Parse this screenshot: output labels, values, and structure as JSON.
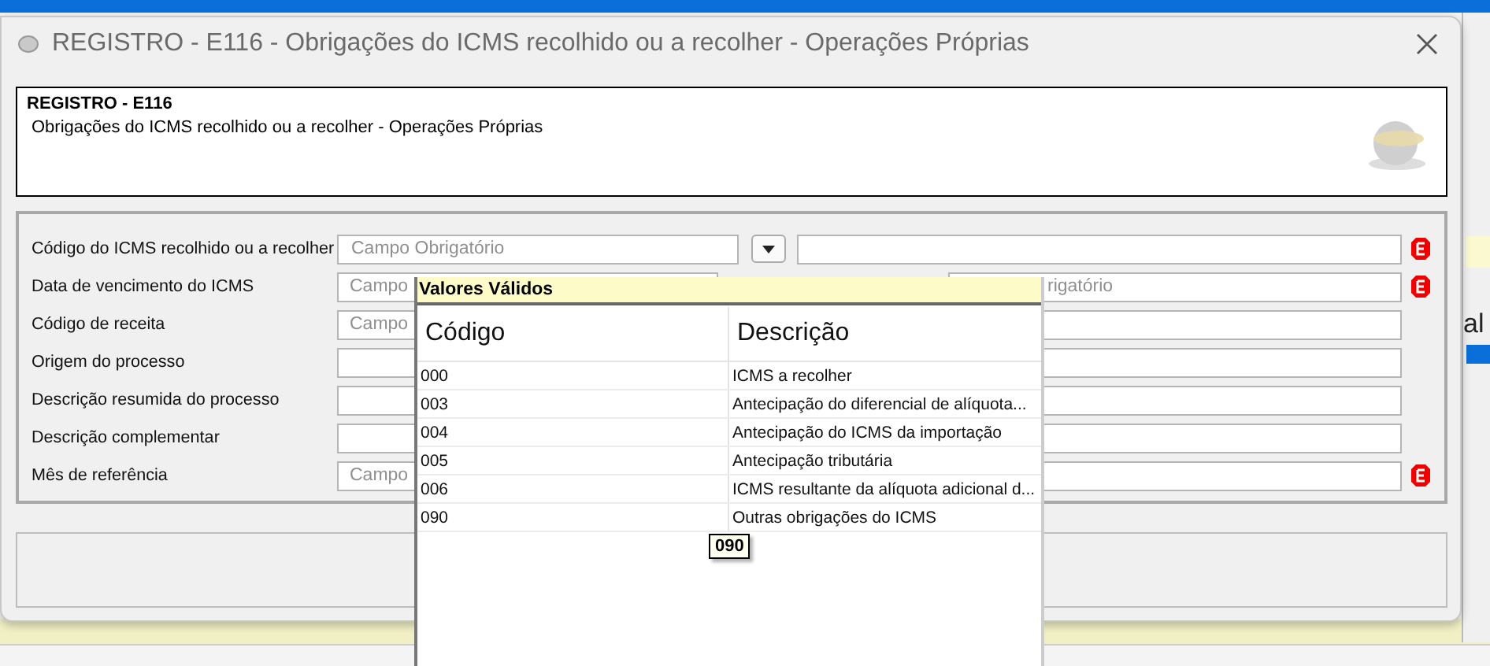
{
  "window": {
    "title": "REGISTRO - E116 - Obrigações do ICMS recolhido ou a recolher - Operações Próprias"
  },
  "header": {
    "code": "REGISTRO - E116",
    "description": "Obrigações do ICMS recolhido ou a recolher - Operações Próprias"
  },
  "fields": [
    {
      "label": "Código do ICMS recolhido ou a recolher",
      "kind": "combo",
      "placeholder": "Campo Obrigatório",
      "required": true
    },
    {
      "label": "Data de vencimento do ICMS",
      "kind": "pair",
      "placeholder": "Campo",
      "placeholder_right": "rigatório",
      "required": true
    },
    {
      "label": "Código de receita",
      "kind": "pair",
      "placeholder": "Campo",
      "required": false
    },
    {
      "label": "Origem do processo",
      "kind": "pair",
      "required": false
    },
    {
      "label": "Descrição resumida do processo",
      "kind": "pair",
      "required": false
    },
    {
      "label": "Descrição complementar",
      "kind": "pair",
      "required": false
    },
    {
      "label": "Mês de referência",
      "kind": "pair",
      "placeholder": "Campo",
      "required": true
    }
  ],
  "popup": {
    "title": "Valores Válidos",
    "columns": [
      "Código",
      "Descrição"
    ],
    "rows": [
      {
        "code": "000",
        "description": "ICMS a recolher"
      },
      {
        "code": "003",
        "description": "Antecipação do diferencial de alíquota..."
      },
      {
        "code": "004",
        "description": "Antecipação do ICMS da importação"
      },
      {
        "code": "005",
        "description": "Antecipação tributária"
      },
      {
        "code": "006",
        "description": "ICMS resultante da alíquota adicional d..."
      },
      {
        "code": "090",
        "description": "Outras obrigações do ICMS"
      }
    ],
    "tooltip": "090"
  },
  "background_fragment": "al"
}
